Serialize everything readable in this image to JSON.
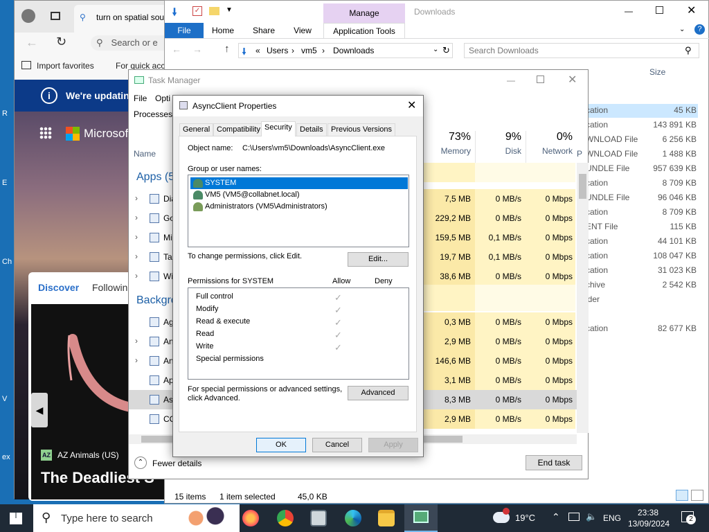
{
  "desktop": {
    "labels": [
      "R",
      "E",
      "Ch",
      "V",
      "ex"
    ]
  },
  "edge": {
    "tab_title": "turn on spatial sou",
    "address_placeholder": "Search or e",
    "favorites": {
      "import": "Import favorites",
      "quick": "For quick acc"
    },
    "banner_text": "We're updating",
    "brand": "Microsoft",
    "feed_tabs": {
      "discover": "Discover",
      "following": "Followin"
    },
    "article": {
      "source": "AZ Animals (US)",
      "headline": "The Deadliest S"
    }
  },
  "explorer": {
    "title": "Downloads",
    "ribbon": {
      "file": "File",
      "home": "Home",
      "share": "Share",
      "view": "View",
      "manage": "Manage",
      "app_tools": "Application Tools"
    },
    "breadcrumb": [
      "Users",
      "vm5",
      "Downloads"
    ],
    "breadcrumb_prefix": "«",
    "search_placeholder": "Search Downloads",
    "size_header": "Size",
    "items": [
      {
        "type": "cation",
        "size": "45 KB"
      },
      {
        "type": "cation",
        "size": "143 891 KB"
      },
      {
        "type": "WNLOAD File",
        "size": "6 256 KB"
      },
      {
        "type": "WNLOAD File",
        "size": "1 488 KB"
      },
      {
        "type": "UNDLE File",
        "size": "957 639 KB"
      },
      {
        "type": "cation",
        "size": "8 709 KB"
      },
      {
        "type": "UNDLE File",
        "size": "96 046 KB"
      },
      {
        "type": "cation",
        "size": "8 709 KB"
      },
      {
        "type": "ENT File",
        "size": "115 KB"
      },
      {
        "type": "cation",
        "size": "44 101 KB"
      },
      {
        "type": "cation",
        "size": "108 047 KB"
      },
      {
        "type": "cation",
        "size": "31 023 KB"
      },
      {
        "type": "chive",
        "size": "2 542 KB"
      },
      {
        "type": "lder",
        "size": ""
      },
      {
        "type": "",
        "size": ""
      },
      {
        "type": "cation",
        "size": "82 677 KB"
      }
    ],
    "status": {
      "count": "15 items",
      "selected": "1 item selected",
      "sel_size": "45,0 KB"
    }
  },
  "taskmgr": {
    "title": "Task Manager",
    "menu": {
      "file": "File",
      "options": "Opti"
    },
    "tab_processes": "Processes",
    "col_name": "Name",
    "memory": {
      "pct": "73%",
      "label": "Memory"
    },
    "disk": {
      "pct": "9%",
      "label": "Disk"
    },
    "network": {
      "pct": "0%",
      "label": "Network"
    },
    "col_p": "P",
    "apps_group": "Apps (5",
    "bg_group": "Backgro",
    "rows": [
      {
        "name": "Dia",
        "mem": "7,5 MB",
        "disk": "0 MB/s",
        "net": "0 Mbps"
      },
      {
        "name": "Go",
        "mem": "229,2 MB",
        "disk": "0 MB/s",
        "net": "0 Mbps"
      },
      {
        "name": "Mi",
        "mem": "159,5 MB",
        "disk": "0,1 MB/s",
        "net": "0 Mbps"
      },
      {
        "name": "Tas",
        "mem": "19,7 MB",
        "disk": "0,1 MB/s",
        "net": "0 Mbps"
      },
      {
        "name": "Wi",
        "mem": "38,6 MB",
        "disk": "0 MB/s",
        "net": "0 Mbps"
      },
      {
        "name": "Ag",
        "mem": "0,3 MB",
        "disk": "0 MB/s",
        "net": "0 Mbps"
      },
      {
        "name": "An",
        "mem": "2,9 MB",
        "disk": "0 MB/s",
        "net": "0 Mbps"
      },
      {
        "name": "An",
        "mem": "146,6 MB",
        "disk": "0 MB/s",
        "net": "0 Mbps"
      },
      {
        "name": "Ap",
        "mem": "3,1 MB",
        "disk": "0 MB/s",
        "net": "0 Mbps"
      },
      {
        "name": "As",
        "mem": "8,3 MB",
        "disk": "0 MB/s",
        "net": "0 Mbps"
      },
      {
        "name": "CO",
        "mem": "2,9 MB",
        "disk": "0 MB/s",
        "net": "0 Mbps"
      }
    ],
    "fewer_details": "Fewer details",
    "end_task": "End task"
  },
  "dialog": {
    "title": "AsyncClient Properties",
    "tabs": [
      "General",
      "Compatibility",
      "Security",
      "Details",
      "Previous Versions"
    ],
    "object_label": "Object name:",
    "object_value": "C:\\Users\\vm5\\Downloads\\AsyncClient.exe",
    "group_label": "Group or user names:",
    "users": [
      "SYSTEM",
      "VM5 (VM5@collabnet.local)",
      "Administrators (VM5\\Administrators)"
    ],
    "change_text": "To change permissions, click Edit.",
    "edit_btn": "Edit...",
    "perm_label": "Permissions for SYSTEM",
    "allow": "Allow",
    "deny": "Deny",
    "permissions": [
      {
        "name": "Full control",
        "allow": true
      },
      {
        "name": "Modify",
        "allow": true
      },
      {
        "name": "Read & execute",
        "allow": true
      },
      {
        "name": "Read",
        "allow": true
      },
      {
        "name": "Write",
        "allow": true
      },
      {
        "name": "Special permissions",
        "allow": false
      }
    ],
    "special_text1": "For special permissions or advanced settings,",
    "special_text2": "click Advanced.",
    "advanced_btn": "Advanced",
    "ok": "OK",
    "cancel": "Cancel",
    "apply": "Apply"
  },
  "taskbar": {
    "search_placeholder": "Type here to search",
    "temp": "19°C",
    "lang": "ENG",
    "time": "23:38",
    "date": "13/09/2024",
    "notif_count": "2",
    "colors": {
      "bg": "#1f2a36",
      "accent": "#0078d7"
    }
  }
}
